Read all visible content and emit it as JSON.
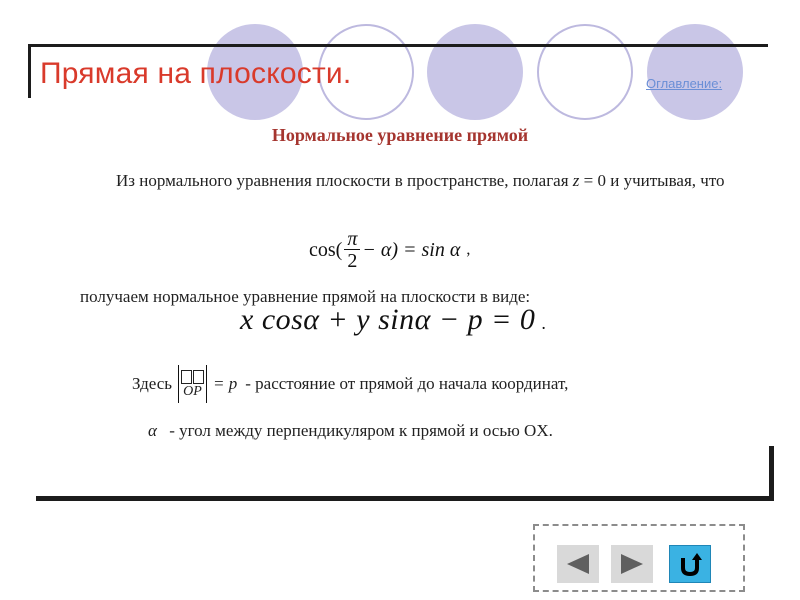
{
  "header": {
    "title": "Прямая на плоскости.",
    "toc_link": "Оглавление:"
  },
  "content": {
    "heading": "Нормальное уравнение прямой",
    "intro_text": "Из нормального уравнения плоскости в пространстве, полагая",
    "intro_var": "z",
    "intro_eq": " = 0 и учитывая, что",
    "formula1": {
      "left": "cos(",
      "frac_num": "π",
      "frac_den": "2",
      "right": "− α) = sin α",
      "tail": ","
    },
    "line2": "получаем нормальное уравнение прямой на плоскости в виде:",
    "formula2": "x cosα + y sinα − p = 0",
    "formula2_period": ".",
    "here_prefix": "Здесь",
    "here_vector": "OP",
    "here_eq": "= p",
    "here_suffix": "- расстояние от прямой до начала координат,",
    "alpha_symbol": "α",
    "alpha_text": "- угол между перпендикуляром к прямой и осью OX."
  },
  "nav": {
    "prev_icon": "arrow-left-icon",
    "next_icon": "arrow-right-icon",
    "back_icon": "u-turn-icon"
  },
  "colors": {
    "title": "#d93a2b",
    "heading": "#a5352f",
    "link": "#6b8fd6",
    "circle_fill": "#c9c6e7",
    "circle_ring": "#bdb9df",
    "nav_gray": "#d9d9d9",
    "nav_blue": "#3ab2e3"
  }
}
